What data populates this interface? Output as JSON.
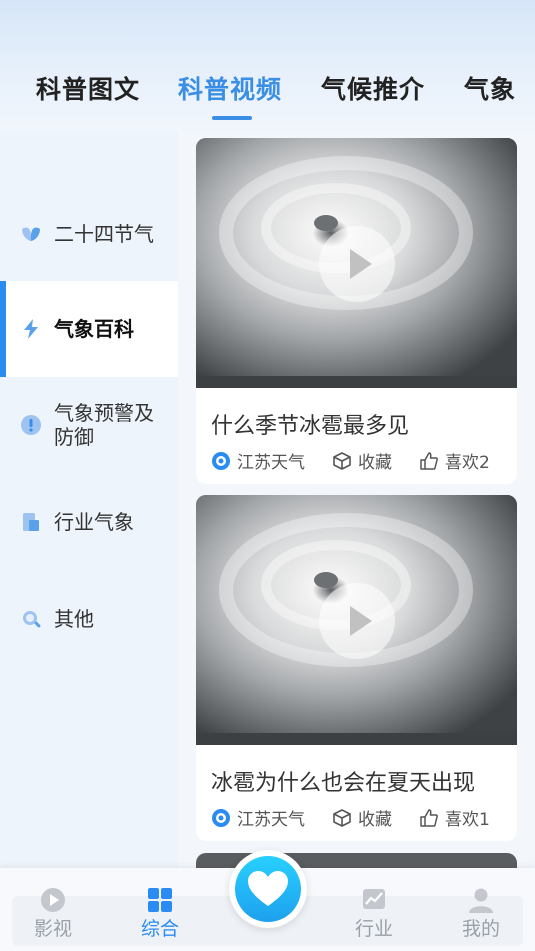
{
  "tabs": [
    {
      "label": "科普图文",
      "active": false
    },
    {
      "label": "科普视频",
      "active": true
    },
    {
      "label": "气候推介",
      "active": false
    },
    {
      "label": "气象",
      "active": false
    }
  ],
  "sidebar": {
    "items": [
      {
        "label": "二十四节气",
        "icon": "leaf-icon",
        "active": false
      },
      {
        "label": "气象百科",
        "icon": "lightning-icon",
        "active": true
      },
      {
        "label": "气象预警及防御",
        "icon": "warning-icon",
        "active": false
      },
      {
        "label": "行业气象",
        "icon": "document-icon",
        "active": false
      },
      {
        "label": "其他",
        "icon": "magnifier-icon",
        "active": false
      }
    ]
  },
  "videos": [
    {
      "title": "什么季节冰雹最多见",
      "source": "江苏天气",
      "collect_label": "收藏",
      "like_label": "喜欢2"
    },
    {
      "title": "冰雹为什么也会在夏天出现",
      "source": "江苏天气",
      "collect_label": "收藏",
      "like_label": "喜欢1"
    }
  ],
  "bottom_nav": [
    {
      "label": "影视",
      "icon": "play-circle-icon",
      "active": false
    },
    {
      "label": "综合",
      "icon": "grid-icon",
      "active": true
    },
    {
      "label": "行业",
      "icon": "chart-icon",
      "active": false
    },
    {
      "label": "我的",
      "icon": "person-icon",
      "active": false
    }
  ],
  "colors": {
    "accent": "#3a8ee6",
    "sidebar_bg": "#eef4fb",
    "fab": "#1ea0ee"
  }
}
